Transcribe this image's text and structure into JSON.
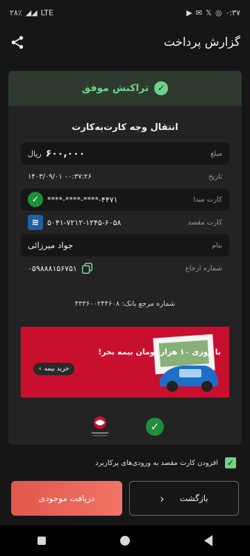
{
  "status_bar": {
    "time": "۰:۳۷",
    "network": "LTE",
    "battery": "۲۸٪"
  },
  "header": {
    "title": "گزارش پرداخت"
  },
  "receipt": {
    "status": "تراکنش موفق",
    "title": "انتقال وجه کارت‌به‌کارت",
    "rows": {
      "amount": {
        "label": "مبلغ",
        "value": "۶۰۰,۰۰۰",
        "unit": "ریال"
      },
      "date": {
        "label": "تاریخ",
        "value": "۱۴۰۳/۰۹/۰۱   ۰۰:۳۷:۲۶"
      },
      "source_card": {
        "label": "کارت مبدا",
        "value": "****-****-****-۴۴۷۱"
      },
      "dest_card": {
        "label": "کارت مقصد",
        "value": "۵۰۴۱-۷۲۱۲-۱۲۴۵-۶۰۵۸"
      },
      "name": {
        "label": "بنام",
        "value": "جواد میرزائی"
      },
      "tracking": {
        "label": "شماره ارجاع",
        "value": "۰۵۹۸۸۸۱۵۶۷۵۱"
      }
    },
    "bank_ref": "شماره مرجع بانک: ۴۳۳۶۰۰۲۴۴۶۰۸"
  },
  "ad": {
    "title": "با روزی ۱۰ هزار تومان بیمه بخر!",
    "button": "خرید بیمه"
  },
  "checkbox": {
    "label": "افزودن کارت مقصد به ورودی‌های پرکاربرد",
    "checked": true
  },
  "buttons": {
    "back": "بازگشت",
    "balance": "دریافت موجودی"
  },
  "colors": {
    "success": "#6fd28a",
    "primary_button": "#e2574c",
    "ad_bg": "#c8102e"
  }
}
